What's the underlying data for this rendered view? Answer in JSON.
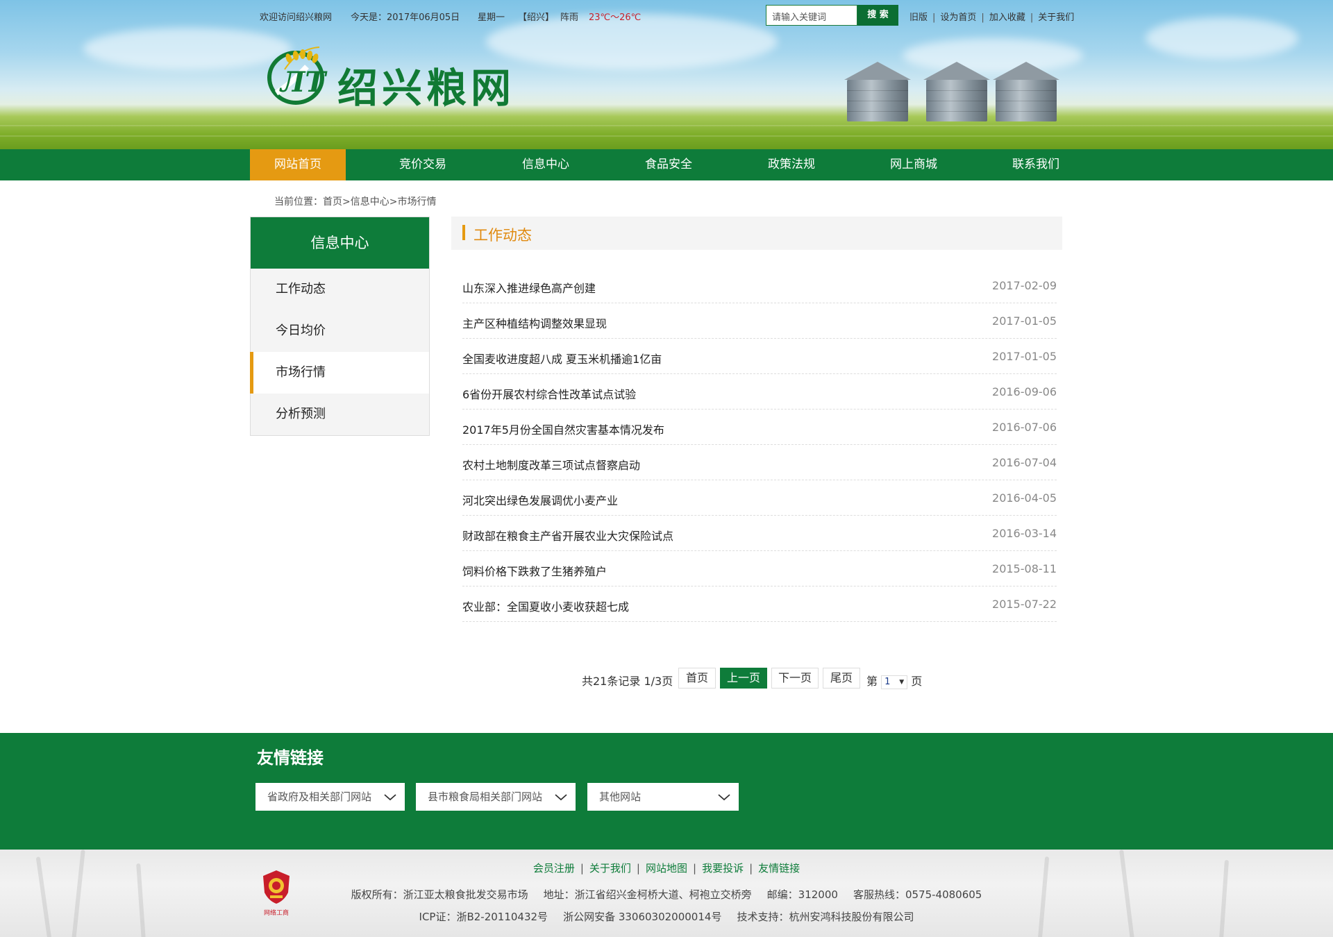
{
  "topbar": {
    "welcome": "欢迎访问绍兴粮网",
    "date": "今天是：2017年06月05日",
    "weekday": "星期一",
    "city": "【绍兴】",
    "weather": "阵雨",
    "temperature": "23℃～26℃",
    "search_placeholder": "请输入关键词",
    "search_button": "搜 索",
    "links": [
      "旧版",
      "设为首页",
      "加入收藏",
      "关于我们"
    ]
  },
  "logo": {
    "title": "绍兴粮网"
  },
  "nav": {
    "items": [
      "网站首页",
      "竞价交易",
      "信息中心",
      "食品安全",
      "政策法规",
      "网上商城",
      "联系我们"
    ],
    "active_index": 0
  },
  "breadcrumb": "当前位置：首页>信息中心>市场行情",
  "sidebar": {
    "title": "信息中心",
    "items": [
      "工作动态",
      "今日均价",
      "市场行情",
      "分析预测"
    ],
    "active_index": 2
  },
  "section": {
    "title": "工作动态"
  },
  "news": [
    {
      "title": "山东深入推进绿色高产创建",
      "date": "2017-02-09"
    },
    {
      "title": "主产区种植结构调整效果显现",
      "date": "2017-01-05"
    },
    {
      "title": "全国麦收进度超八成 夏玉米机播逾1亿亩",
      "date": "2017-01-05"
    },
    {
      "title": "6省份开展农村综合性改革试点试验",
      "date": "2016-09-06"
    },
    {
      "title": "2017年5月份全国自然灾害基本情况发布",
      "date": "2016-07-06"
    },
    {
      "title": "农村土地制度改革三项试点督察启动",
      "date": "2016-07-04"
    },
    {
      "title": "河北突出绿色发展调优小麦产业",
      "date": "2016-04-05"
    },
    {
      "title": "财政部在粮食主产省开展农业大灾保险试点",
      "date": "2016-03-14"
    },
    {
      "title": "饲料价格下跌救了生猪养殖户",
      "date": "2015-08-11"
    },
    {
      "title": "农业部：全国夏收小麦收获超七成",
      "date": "2015-07-22"
    }
  ],
  "pager": {
    "info": "共21条记录 1/3页",
    "first": "首页",
    "prev": "上一页",
    "next": "下一页",
    "last": "尾页",
    "jump_prefix": "第",
    "jump_value": "1",
    "jump_suffix": "页"
  },
  "friends": {
    "title": "友情链接",
    "dropdowns": [
      "省政府及相关部门网站",
      "县市粮食局相关部门网站",
      "其他网站"
    ]
  },
  "footer": {
    "links": [
      "会员注册",
      "关于我们",
      "网站地图",
      "我要投诉",
      "友情链接"
    ],
    "copyright": "版权所有：浙江亚太粮食批发交易市场",
    "address": "地址：浙江省绍兴金柯桥大道、柯袍立交桥旁",
    "postcode": "邮编：312000",
    "hotline": "客服热线：0575-4080605",
    "icp": "ICP证：浙B2-20110432号",
    "police": "浙公网安备 33060302000014号",
    "support": "技术支持：杭州安鸿科技股份有限公司",
    "emblem_caption": "网络工商"
  },
  "colors": {
    "brand_green": "#0e7c3a",
    "accent_orange": "#e59a12",
    "temperature_red": "#c8202a"
  }
}
